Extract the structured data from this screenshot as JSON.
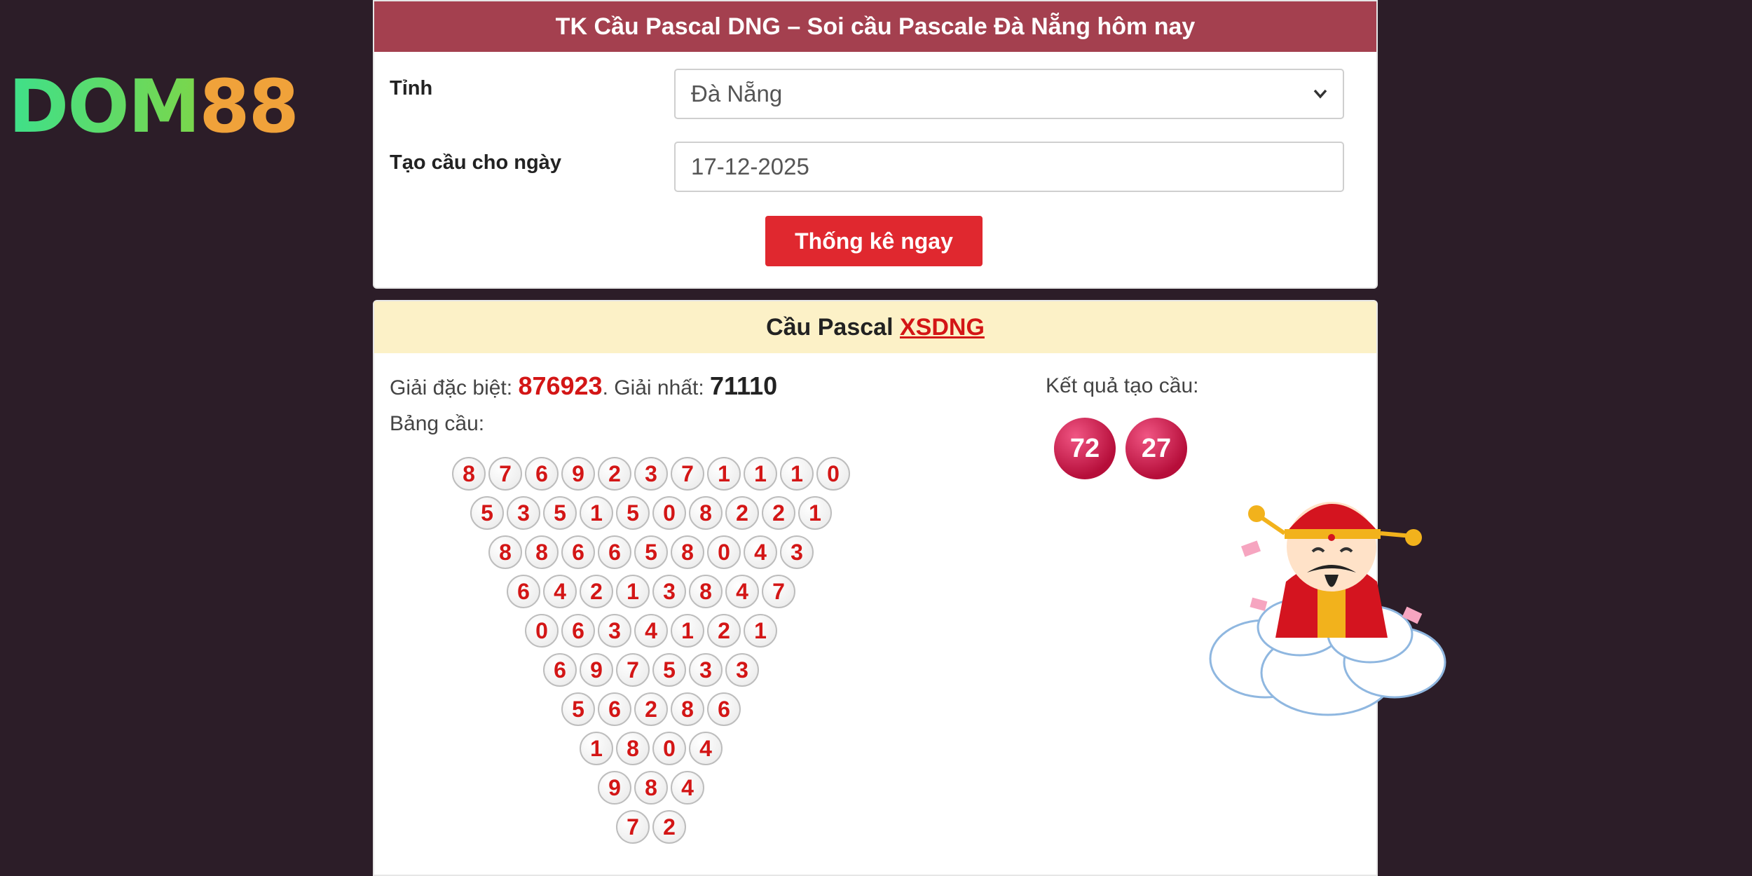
{
  "brand": {
    "logo_left": "DOM",
    "logo_right": "88"
  },
  "form": {
    "title": "TK Cầu Pascal DNG – Soi cầu Pascale Đà Nẵng hôm nay",
    "province_label": "Tỉnh",
    "province_value": "Đà Nẵng",
    "date_label": "Tạo cầu cho ngày",
    "date_value": "17-12-2025",
    "submit_label": "Thống kê ngay"
  },
  "result": {
    "title_prefix": "Cầu Pascal",
    "title_link": "XSDNG",
    "special_label": "Giải đặc biệt:",
    "special_value": "876923",
    "first_label": ". Giải nhất:",
    "first_value": "71110",
    "table_label": "Bảng cầu:",
    "outcome_label": "Kết quả tạo cầu:",
    "outcome_numbers": [
      "72",
      "27"
    ],
    "pascal_rows": [
      [
        "8",
        "7",
        "6",
        "9",
        "2",
        "3",
        "7",
        "1",
        "1",
        "1",
        "0"
      ],
      [
        "5",
        "3",
        "5",
        "1",
        "5",
        "0",
        "8",
        "2",
        "2",
        "1"
      ],
      [
        "8",
        "8",
        "6",
        "6",
        "5",
        "8",
        "0",
        "4",
        "3"
      ],
      [
        "6",
        "4",
        "2",
        "1",
        "3",
        "8",
        "4",
        "7"
      ],
      [
        "0",
        "6",
        "3",
        "4",
        "1",
        "2",
        "1"
      ],
      [
        "6",
        "9",
        "7",
        "5",
        "3",
        "3"
      ],
      [
        "5",
        "6",
        "2",
        "8",
        "6"
      ],
      [
        "1",
        "8",
        "0",
        "4"
      ],
      [
        "9",
        "8",
        "4"
      ],
      [
        "7",
        "2"
      ]
    ]
  },
  "icons": {
    "mascot": "god-of-wealth-on-cloud-illustration",
    "dropdown": "chevron-down-icon"
  },
  "colors": {
    "header_bar": "#a4404f",
    "button": "#e0282f",
    "accent_red": "#d31616",
    "highlight_bg": "#fcf1c7",
    "page_bg": "#2c1d28"
  }
}
